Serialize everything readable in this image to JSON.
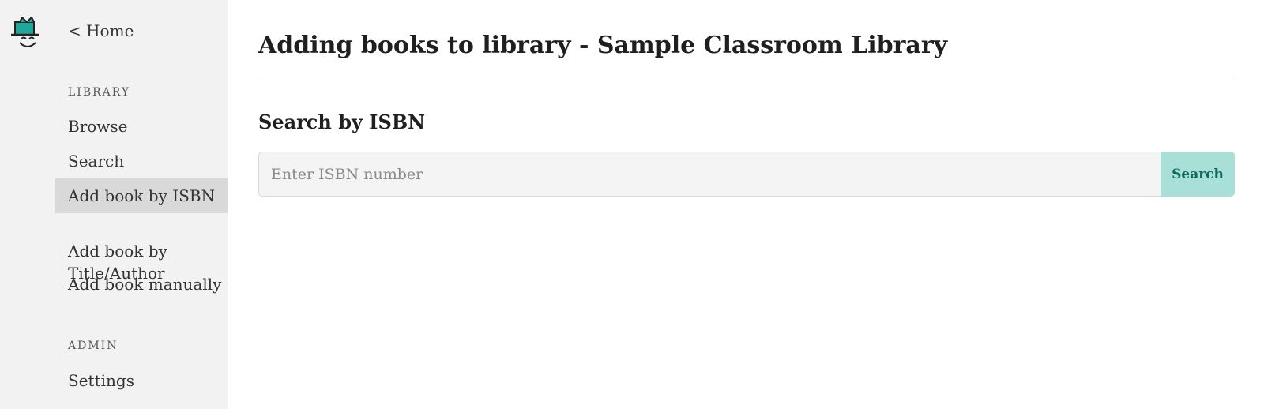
{
  "rail": {
    "logo_icon": "mascot-face-icon",
    "logo_accent_color": "#1fa89a"
  },
  "sidebar": {
    "home_link": "< Home",
    "sections": [
      {
        "label": "LIBRARY",
        "items": [
          {
            "label": "Browse",
            "active": false
          },
          {
            "label": "Search",
            "active": false
          },
          {
            "label": "Add book by ISBN",
            "active": true
          },
          {
            "label": "Add book by\nTitle/Author",
            "active": false
          },
          {
            "label": "Add book manually",
            "active": false
          }
        ]
      },
      {
        "label": "ADMIN",
        "items": [
          {
            "label": "Settings",
            "active": false
          }
        ]
      }
    ]
  },
  "main": {
    "page_title": "Adding books to library - Sample Classroom Library",
    "section_title": "Search by ISBN",
    "isbn_input": {
      "value": "",
      "placeholder": "Enter ISBN number"
    },
    "search_button": "Search"
  },
  "colors": {
    "accent_button_bg": "#a8e0d8",
    "accent_button_text": "#0e6b5c",
    "sidebar_bg": "#f2f2f2",
    "active_item_bg": "#d9d9d9"
  }
}
